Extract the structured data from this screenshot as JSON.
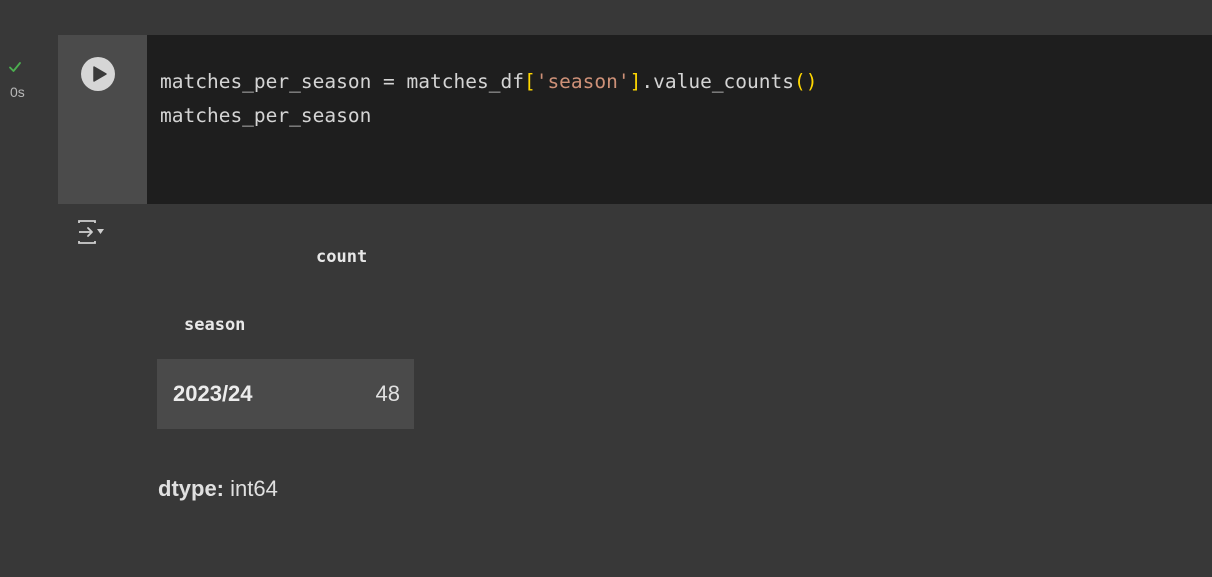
{
  "cell": {
    "status": "completed",
    "status_icon": "checkmark-icon",
    "status_color": "#4caf50",
    "exec_time": "0s",
    "run_icon": "play-icon",
    "code": {
      "line1": {
        "prefix": "matches_per_season = matches_df",
        "open_bracket": "[",
        "string": "'season'",
        "close_bracket": "]",
        "method": ".value_counts",
        "parens": "()"
      },
      "line2": "matches_per_season"
    }
  },
  "output": {
    "toggle_icon": "output-toggle-icon",
    "table": {
      "column_header": "count",
      "index_header": "season",
      "rows": [
        {
          "index": "2023/24",
          "value": "48"
        }
      ]
    },
    "dtype": {
      "label": "dtype:",
      "value": "int64"
    }
  },
  "colors": {
    "page_bg": "#383838",
    "editor_bg": "#1e1e1e",
    "string": "#ce9178",
    "bracket": "#ffd700"
  }
}
